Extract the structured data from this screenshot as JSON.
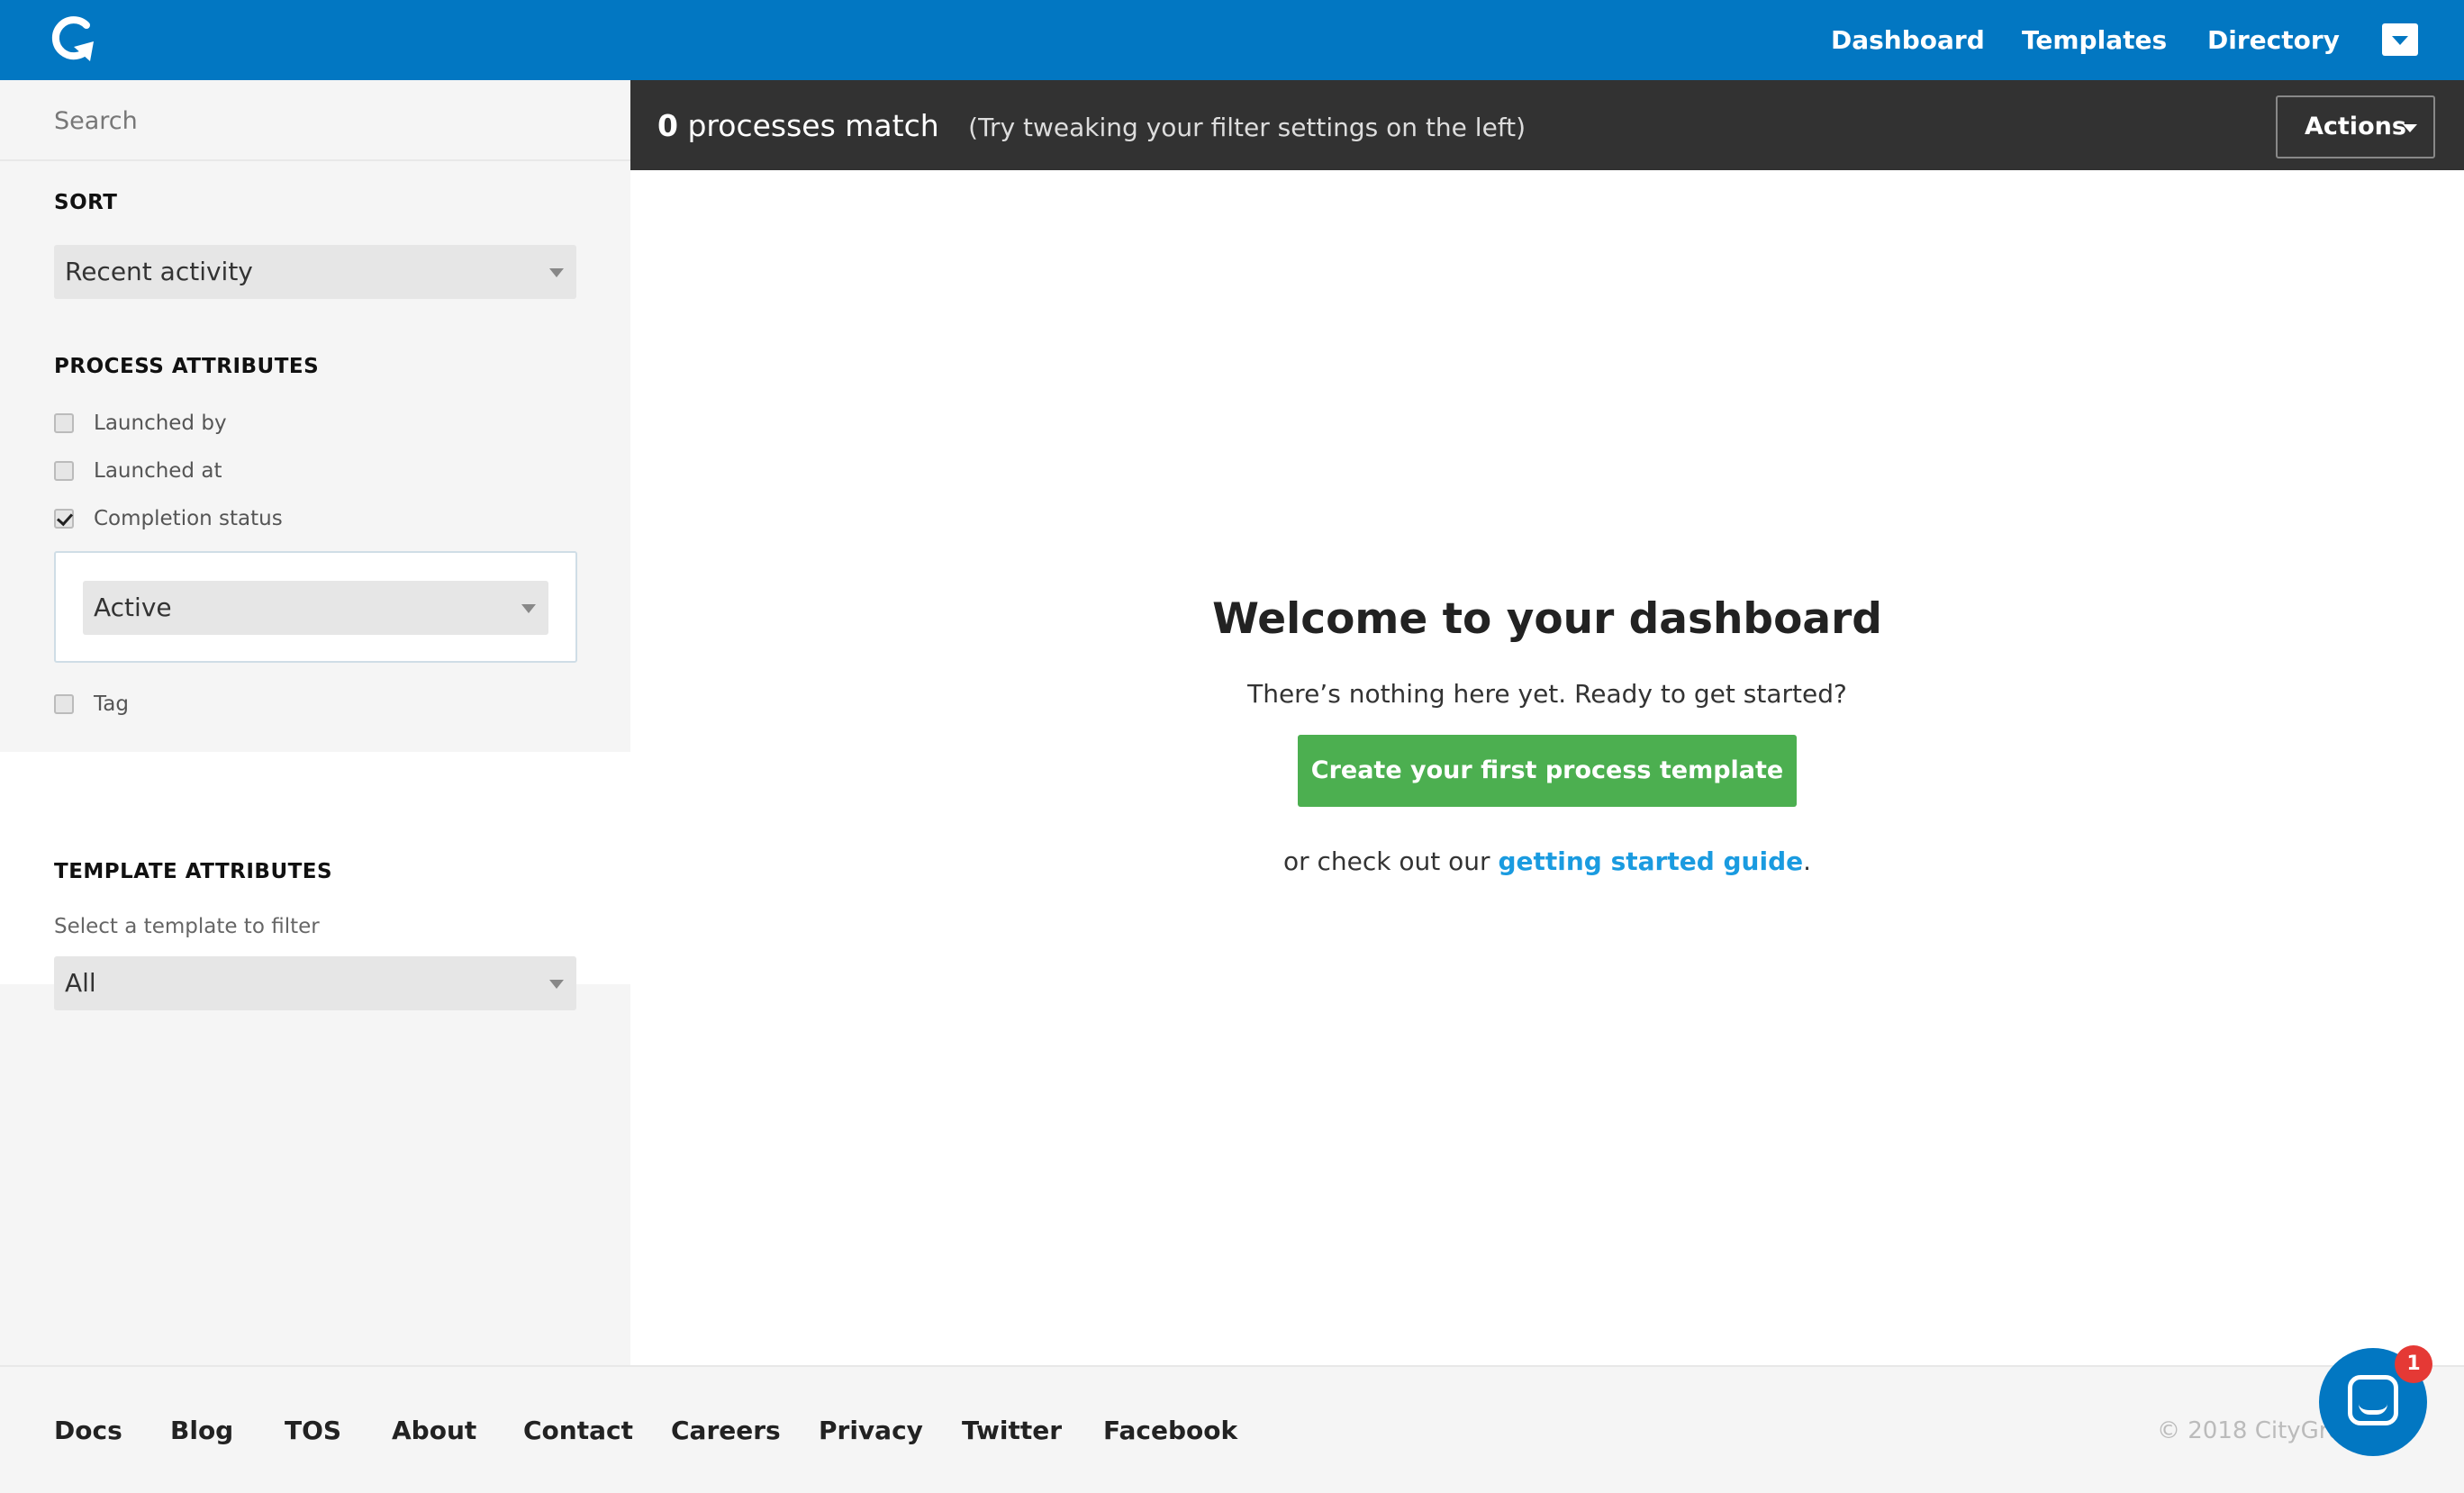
{
  "nav": {
    "links": [
      "Dashboard",
      "Templates",
      "Directory"
    ],
    "menu_icon": "caret-down-icon",
    "brand_color": "#0277c2"
  },
  "sidebar": {
    "search_placeholder": "Search",
    "sort": {
      "heading": "SORT",
      "selected": "Recent activity"
    },
    "process_attributes": {
      "heading": "PROCESS ATTRIBUTES",
      "checkboxes": [
        {
          "label": "Launched by",
          "checked": false
        },
        {
          "label": "Launched at",
          "checked": false
        },
        {
          "label": "Completion status",
          "checked": true
        },
        {
          "label": "Tag",
          "checked": false
        }
      ],
      "completion_status_selected": "Active"
    },
    "template_attributes": {
      "heading": "TEMPLATE ATTRIBUTES",
      "hint": "Select a template to filter",
      "selected": "All"
    }
  },
  "mainbar": {
    "count": "0",
    "match_text": "processes match",
    "tip": "(Try tweaking your filter settings on the left)",
    "actions_label": "Actions"
  },
  "welcome": {
    "title": "Welcome to your dashboard",
    "subtitle": "There’s nothing here yet. Ready to get started?",
    "cta_label": "Create your first process template",
    "guide_prefix": "or check out our ",
    "guide_link": "getting started guide",
    "guide_suffix": ".",
    "cta_color": "#4caf50"
  },
  "footer": {
    "links": [
      "Docs",
      "Blog",
      "TOS",
      "About",
      "Contact",
      "Careers",
      "Privacy",
      "Twitter",
      "Facebook"
    ],
    "copyright": "© 2018 CityGro"
  },
  "chat": {
    "badge_count": "1",
    "icon": "chat-icon"
  }
}
